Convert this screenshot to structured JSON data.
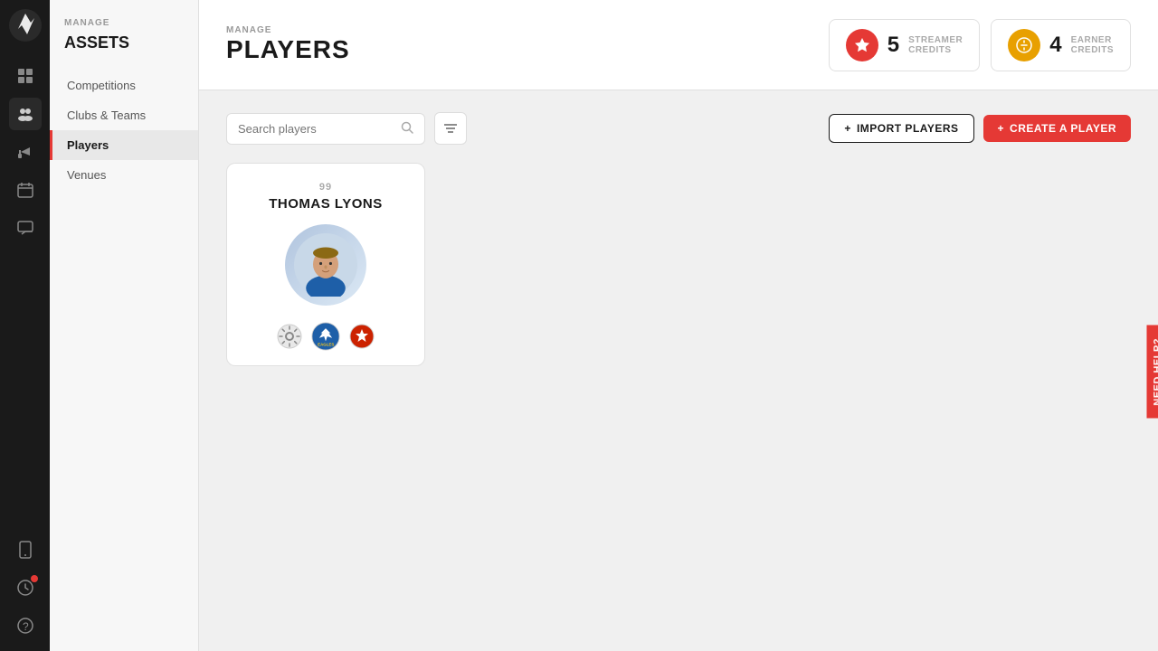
{
  "app": {
    "logo_text": "⚡",
    "title": "ASSETS",
    "manage_label": "MANAGE"
  },
  "icon_nav": {
    "items": [
      {
        "id": "dashboard",
        "icon": "⊞",
        "active": false
      },
      {
        "id": "people",
        "icon": "👥",
        "active": true
      },
      {
        "id": "megaphone",
        "icon": "📣",
        "active": false
      },
      {
        "id": "calendar",
        "icon": "📅",
        "active": false
      },
      {
        "id": "chat",
        "icon": "💬",
        "active": false
      }
    ],
    "bottom_items": [
      {
        "id": "mobile",
        "icon": "📱",
        "notification": false
      },
      {
        "id": "activity",
        "icon": "📊",
        "notification": true
      },
      {
        "id": "help",
        "icon": "❓",
        "notification": false
      }
    ]
  },
  "sidebar": {
    "section_label": "MANAGE",
    "title": "ASSETS",
    "nav_items": [
      {
        "id": "competitions",
        "label": "Competitions",
        "active": false
      },
      {
        "id": "clubs-teams",
        "label": "Clubs & Teams",
        "active": false
      },
      {
        "id": "players",
        "label": "Players",
        "active": true
      },
      {
        "id": "venues",
        "label": "Venues",
        "active": false
      }
    ]
  },
  "topbar": {
    "manage_label": "MANAGE",
    "title": "PLAYERS"
  },
  "credits": [
    {
      "id": "streamer",
      "count": "5",
      "label_top": "STREAMER",
      "label_bottom": "CREDITS",
      "color": "streamer"
    },
    {
      "id": "earner",
      "count": "4",
      "label_top": "EARNER",
      "label_bottom": "CREDITS",
      "color": "earner"
    }
  ],
  "toolbar": {
    "search_placeholder": "Search players",
    "import_label": "IMPORT PLAYERS",
    "create_label": "CREATE A PLAYER"
  },
  "players": [
    {
      "id": "thomas-lyons",
      "number": "99",
      "name": "THOMAS LYONS",
      "teams": [
        "gear",
        "eagles",
        "badge"
      ]
    }
  ],
  "need_help": {
    "label": "Need Help?"
  }
}
